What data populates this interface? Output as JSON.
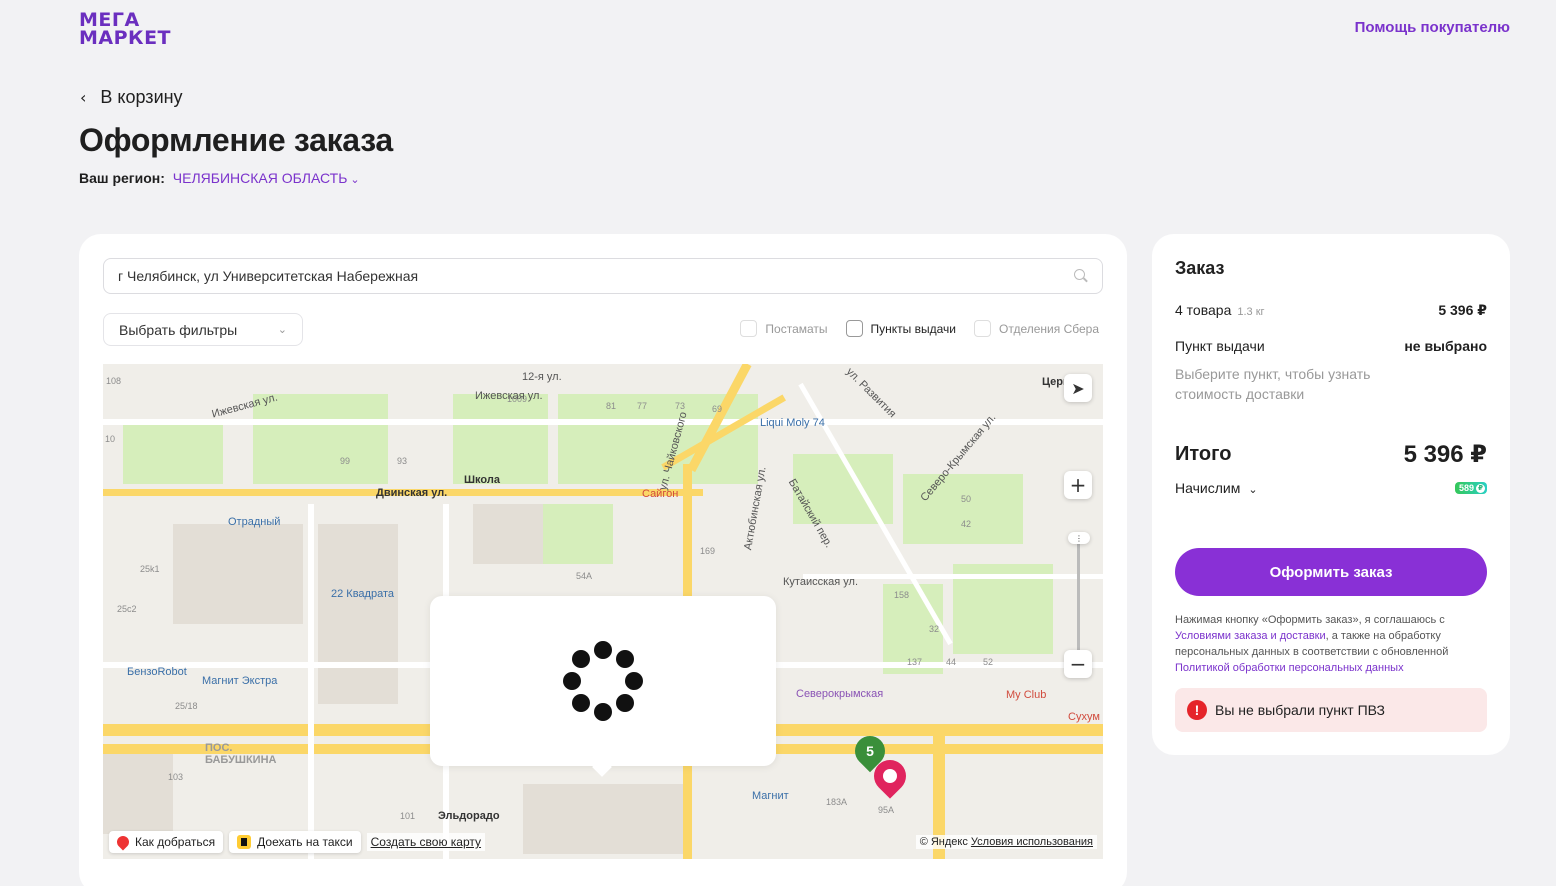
{
  "header": {
    "logo_line1": "МЕГА",
    "logo_line2": "МАРКЕТ",
    "help": "Помощь покупателю"
  },
  "nav": {
    "back": "В корзину"
  },
  "page": {
    "title": "Оформление заказа",
    "region_label": "Ваш регион:",
    "region_value": "ЧЕЛЯБИНСКАЯ ОБЛАСТЬ"
  },
  "pickup": {
    "search_value": "г Челябинск, ул Университетская Набережная",
    "filters_label": "Выбрать фильтры",
    "checkboxes": [
      {
        "label": "Постаматы",
        "checked": false,
        "enabled": false
      },
      {
        "label": "Пункты выдачи",
        "checked": false,
        "enabled": true
      },
      {
        "label": "Отделения Сбера",
        "checked": false,
        "enabled": false
      }
    ]
  },
  "map": {
    "labels": {
      "street_dvinskaya": "Двинская ул.",
      "street_izhevskaya": "Ижевская ул.",
      "street_12": "12-я ул.",
      "street_chaikovskogo": "ул. Чайковского",
      "street_kutaisskaya": "Кутаисская ул.",
      "street_aktyubinskaya": "Актюбинская ул.",
      "street_batayskiy": "Батайский пер.",
      "street_severo": "Северо-Крымская ул.",
      "street_razvitiya": "ул. Развития",
      "poi_school": "Школа",
      "poi_saigon": "Сайгон",
      "poi_liqui": "Liqui Moly 74",
      "poi_otradny": "Отрадный",
      "poi_22kv": "22 Квадрата",
      "poi_benzo": "БензоRobot",
      "poi_magnit_extra": "Магнит Экстра",
      "poi_babushkina": "ПОС. БАБУШКИНА",
      "poi_eldorado": "Эльдорадо",
      "poi_magnit": "Магнит",
      "poi_severokrym": "Северокрымская",
      "poi_myclub": "My Club",
      "poi_sukhum": "Сухум",
      "poi_church": "Церковь"
    },
    "marker_count": "5",
    "route": "Как добраться",
    "taxi": "Доехать на такси",
    "create_map": "Создать свою карту",
    "attribution": "© Яндекс",
    "terms": "Условия использования"
  },
  "summary": {
    "title": "Заказ",
    "items_label": "4 товара",
    "items_weight": "1.3 кг",
    "items_price": "5 396 ₽",
    "pickup_label": "Пункт выдачи",
    "pickup_value": "не выбрано",
    "pickup_hint": "Выберите пункт, чтобы узнать стоимость доставки",
    "total_label": "Итого",
    "total_value": "5 396 ₽",
    "accrue_label": "Начислим",
    "bonus_value": "589",
    "order_button": "Оформить заказ",
    "legal_1": "Нажимая кнопку «Оформить заказ», я соглашаюсь с ",
    "legal_link1": "Условиями заказа и доставки",
    "legal_2": ", а также на обработку персональных данных в соответствии с обновленной ",
    "legal_link2": "Политикой обработки персональных данных",
    "alert": "Вы не выбрали пункт ПВЗ"
  },
  "colors": {
    "brand": "#8930d6",
    "link": "#7b33cc",
    "alert_bg": "#fbe8e8",
    "alert_icon": "#e5252a"
  }
}
